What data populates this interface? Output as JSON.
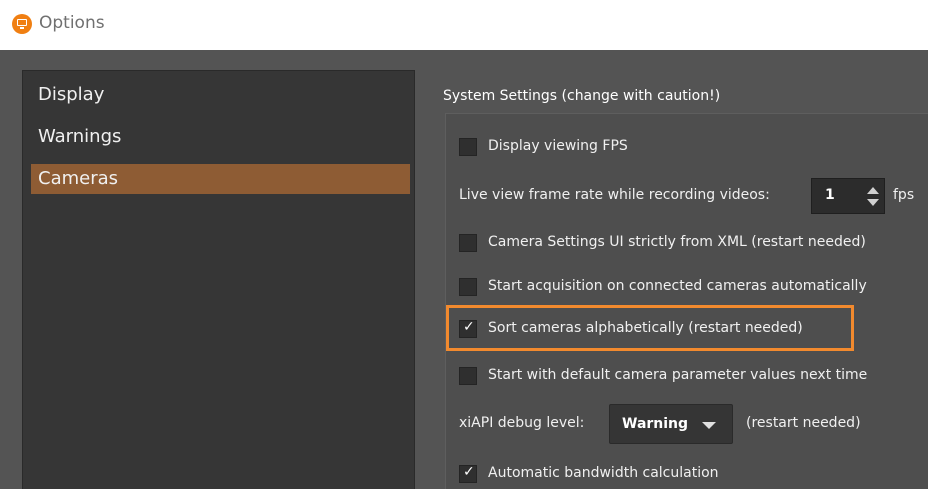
{
  "window": {
    "title": "Options"
  },
  "sidebar": {
    "items": [
      {
        "label": "Display",
        "selected": false
      },
      {
        "label": "Warnings",
        "selected": false
      },
      {
        "label": "Cameras",
        "selected": true
      }
    ]
  },
  "panel": {
    "title": "System Settings (change with caution!)",
    "display_fps": {
      "label": "Display viewing FPS",
      "checked": false
    },
    "live_view": {
      "label": "Live view frame rate while recording videos:",
      "value": "1",
      "unit": "fps"
    },
    "camera_ui_xml": {
      "label": "Camera Settings UI strictly from XML (restart needed)",
      "checked": false
    },
    "start_acquisition": {
      "label": "Start acquisition on connected cameras automatically",
      "checked": false
    },
    "sort_cameras": {
      "label": "Sort cameras alphabetically (restart needed)",
      "checked": true
    },
    "default_params": {
      "label": "Start with default camera parameter values next time",
      "checked": false
    },
    "debug_level": {
      "label": "xiAPI debug level:",
      "value": "Warning",
      "note": "(restart needed)"
    },
    "auto_bandwidth": {
      "label": "Automatic bandwidth calculation",
      "checked": true
    },
    "check_mark": "✓"
  },
  "colors": {
    "accent_selected": "#8e5c34",
    "highlight_outline": "#f28a2e",
    "app_icon": "#f07f12"
  }
}
